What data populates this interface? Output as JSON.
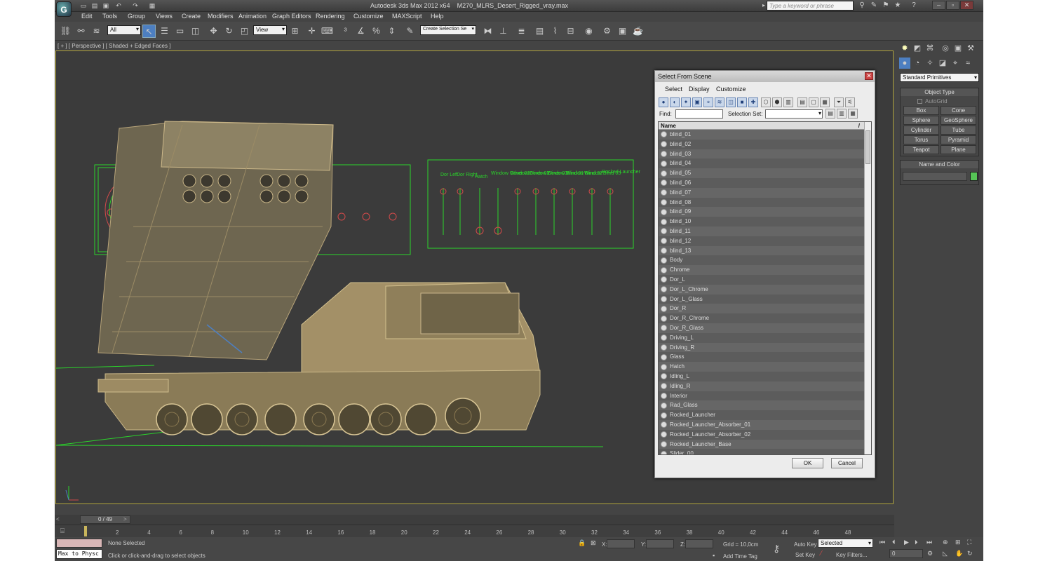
{
  "titlebar": {
    "app_title": "Autodesk 3ds Max  2012 x64",
    "file_name": "M270_MLRS_Desert_Rigged_vray.max",
    "search_placeholder": "Type a keyword or phrase",
    "logo_label": "G"
  },
  "menubar": {
    "items": [
      "Edit",
      "Tools",
      "Group",
      "Views",
      "Create",
      "Modifiers",
      "Animation",
      "Graph Editors",
      "Rendering",
      "Customize",
      "MAXScript",
      "Help"
    ]
  },
  "toolbar": {
    "selection_filter": "All",
    "ref_coord": "View",
    "named_selection": "Create Selection Se"
  },
  "viewport": {
    "label": "[ + ] [ Perspective ] [ Shaded + Edged Faces ]",
    "rig_labels": [
      "Dor Left",
      "Dor Right",
      "Hatch",
      "Window Cover 01",
      "Window Cover 02",
      "Window Cover 03",
      "Window Blind 01",
      "Window Blind 02",
      "Window Blind 03",
      "Rocked Launcher"
    ]
  },
  "dialog": {
    "title": "Select From Scene",
    "menu": [
      "Select",
      "Display",
      "Customize"
    ],
    "find_label": "Find:",
    "selection_set_label": "Selection Set:",
    "column_name": "Name",
    "column_sort": "/",
    "items": [
      "blind_01",
      "blind_02",
      "blind_03",
      "blind_04",
      "blind_05",
      "blind_06",
      "blind_07",
      "blind_08",
      "blind_09",
      "blind_10",
      "blind_11",
      "blind_12",
      "blind_13",
      "Body",
      "Chrome",
      "Dor_L",
      "Dor_L_Chrome",
      "Dor_L_Glass",
      "Dor_R",
      "Dor_R_Chrome",
      "Dor_R_Glass",
      "Driving_L",
      "Driving_R",
      "Glass",
      "Hatch",
      "Idling_L",
      "Idling_R",
      "Interior",
      "Rad_Glass",
      "Rocked_Launcher",
      "Rocked_Launcher_Absorber_01",
      "Rocked_Launcher_Absorber_02",
      "Rocked_Launcher_Base",
      "Slider_00"
    ],
    "ok_label": "OK",
    "cancel_label": "Cancel"
  },
  "command_panel": {
    "category": "Standard Primitives",
    "object_type_header": "Object Type",
    "autogrid_label": "AutoGrid",
    "primitives": [
      "Box",
      "Cone",
      "Sphere",
      "GeoSphere",
      "Cylinder",
      "Tube",
      "Torus",
      "Pyramid",
      "Teapot",
      "Plane"
    ],
    "name_color_header": "Name and Color",
    "swatch_color": "#56c556"
  },
  "timeline": {
    "frame_display": "0 / 49",
    "ticks": [
      "2",
      "4",
      "6",
      "8",
      "10",
      "12",
      "14",
      "16",
      "18",
      "20",
      "22",
      "24",
      "26",
      "28",
      "30",
      "32",
      "34",
      "36",
      "38",
      "40",
      "42",
      "44",
      "46",
      "48"
    ]
  },
  "status": {
    "maxscript_label": "Max to Physc",
    "selection_status": "None Selected",
    "prompt": "Click or click-and-drag to select objects",
    "x_label": "X:",
    "y_label": "Y:",
    "z_label": "Z:",
    "grid": "Grid = 10,0cm",
    "add_time_tag": "Add Time Tag",
    "auto_key": "Auto Key",
    "key_mode": "Selected",
    "set_key": "Set Key",
    "key_filters": "Key Filters...",
    "current_frame": "0"
  },
  "colors": {
    "accent": "#4d7fc1",
    "wire_green": "#2bd42b",
    "vehicle": "#b9a57a",
    "viewport_border": "#b0a43c"
  }
}
